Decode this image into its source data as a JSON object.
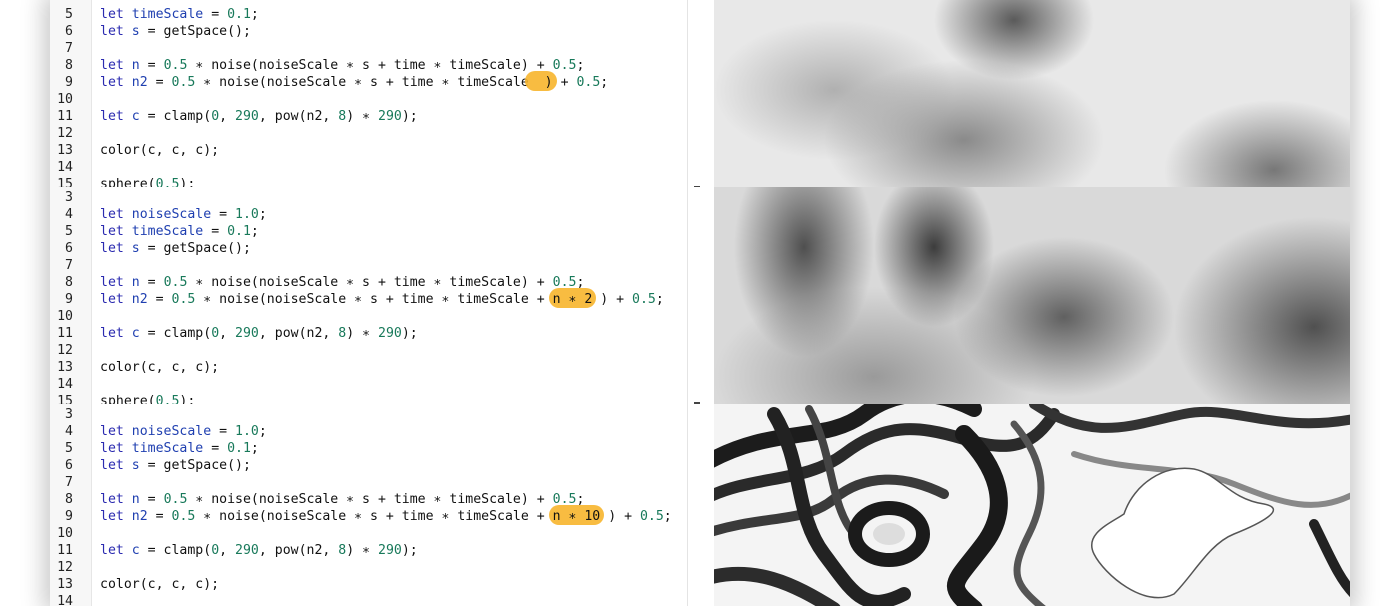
{
  "panels": [
    {
      "lines": [
        {
          "n": "5",
          "tokens": [
            {
              "t": "let",
              "c": "kw"
            },
            {
              "t": " "
            },
            {
              "t": "timeScale",
              "c": "var"
            },
            {
              "t": " = "
            },
            {
              "t": "0.1",
              "c": "num"
            },
            {
              "t": ";"
            }
          ]
        },
        {
          "n": "6",
          "tokens": [
            {
              "t": "let",
              "c": "kw"
            },
            {
              "t": " "
            },
            {
              "t": "s",
              "c": "var"
            },
            {
              "t": " = getSpace();"
            }
          ]
        },
        {
          "n": "7",
          "tokens": []
        },
        {
          "n": "8",
          "tokens": [
            {
              "t": "let",
              "c": "kw"
            },
            {
              "t": " "
            },
            {
              "t": "n",
              "c": "var"
            },
            {
              "t": " = "
            },
            {
              "t": "0.5",
              "c": "num"
            },
            {
              "t": " ∗ noise(noiseScale ∗ s + time ∗ timeScale) + "
            },
            {
              "t": "0.5",
              "c": "num"
            },
            {
              "t": ";"
            }
          ]
        },
        {
          "n": "9",
          "tokens": [
            {
              "t": "let",
              "c": "kw"
            },
            {
              "t": " "
            },
            {
              "t": "n2",
              "c": "var"
            },
            {
              "t": " = "
            },
            {
              "t": "0.5",
              "c": "num"
            },
            {
              "t": " ∗ noise(noiseScale ∗ s + time ∗ timeScale"
            },
            {
              "t": "  )",
              "hl": true
            },
            {
              "t": " + "
            },
            {
              "t": "0.5",
              "c": "num"
            },
            {
              "t": ";"
            }
          ]
        },
        {
          "n": "10",
          "tokens": []
        },
        {
          "n": "11",
          "tokens": [
            {
              "t": "let",
              "c": "kw"
            },
            {
              "t": " "
            },
            {
              "t": "c",
              "c": "var"
            },
            {
              "t": " = clamp("
            },
            {
              "t": "0",
              "c": "num"
            },
            {
              "t": ", "
            },
            {
              "t": "290",
              "c": "num"
            },
            {
              "t": ", pow(n2, "
            },
            {
              "t": "8",
              "c": "num"
            },
            {
              "t": ") ∗ "
            },
            {
              "t": "290",
              "c": "num"
            },
            {
              "t": ");"
            }
          ]
        },
        {
          "n": "12",
          "tokens": []
        },
        {
          "n": "13",
          "tokens": [
            {
              "t": "color(c, c, c);"
            }
          ]
        },
        {
          "n": "14",
          "tokens": []
        },
        {
          "n": "15",
          "tokens": [
            {
              "t": "sphere("
            },
            {
              "t": "0.5",
              "c": "num"
            },
            {
              "t": ");"
            }
          ]
        }
      ]
    },
    {
      "lines": [
        {
          "n": "3",
          "tokens": []
        },
        {
          "n": "4",
          "tokens": [
            {
              "t": "let",
              "c": "kw"
            },
            {
              "t": " "
            },
            {
              "t": "noiseScale",
              "c": "var"
            },
            {
              "t": " = "
            },
            {
              "t": "1.0",
              "c": "num"
            },
            {
              "t": ";"
            }
          ]
        },
        {
          "n": "5",
          "tokens": [
            {
              "t": "let",
              "c": "kw"
            },
            {
              "t": " "
            },
            {
              "t": "timeScale",
              "c": "var"
            },
            {
              "t": " = "
            },
            {
              "t": "0.1",
              "c": "num"
            },
            {
              "t": ";"
            }
          ]
        },
        {
          "n": "6",
          "tokens": [
            {
              "t": "let",
              "c": "kw"
            },
            {
              "t": " "
            },
            {
              "t": "s",
              "c": "var"
            },
            {
              "t": " = getSpace();"
            }
          ]
        },
        {
          "n": "7",
          "tokens": []
        },
        {
          "n": "8",
          "tokens": [
            {
              "t": "let",
              "c": "kw"
            },
            {
              "t": " "
            },
            {
              "t": "n",
              "c": "var"
            },
            {
              "t": " = "
            },
            {
              "t": "0.5",
              "c": "num"
            },
            {
              "t": " ∗ noise(noiseScale ∗ s + time ∗ timeScale) + "
            },
            {
              "t": "0.5",
              "c": "num"
            },
            {
              "t": ";"
            }
          ]
        },
        {
          "n": "9",
          "tokens": [
            {
              "t": "let",
              "c": "kw"
            },
            {
              "t": " "
            },
            {
              "t": "n2",
              "c": "var"
            },
            {
              "t": " = "
            },
            {
              "t": "0.5",
              "c": "num"
            },
            {
              "t": " ∗ noise(noiseScale ∗ s + time ∗ timeScale + "
            },
            {
              "t": "n ∗ 2",
              "hl": true
            },
            {
              "t": " ) + "
            },
            {
              "t": "0.5",
              "c": "num"
            },
            {
              "t": ";"
            }
          ]
        },
        {
          "n": "10",
          "tokens": []
        },
        {
          "n": "11",
          "tokens": [
            {
              "t": "let",
              "c": "kw"
            },
            {
              "t": " "
            },
            {
              "t": "c",
              "c": "var"
            },
            {
              "t": " = clamp("
            },
            {
              "t": "0",
              "c": "num"
            },
            {
              "t": ", "
            },
            {
              "t": "290",
              "c": "num"
            },
            {
              "t": ", pow(n2, "
            },
            {
              "t": "8",
              "c": "num"
            },
            {
              "t": ") ∗ "
            },
            {
              "t": "290",
              "c": "num"
            },
            {
              "t": ");"
            }
          ]
        },
        {
          "n": "12",
          "tokens": []
        },
        {
          "n": "13",
          "tokens": [
            {
              "t": "color(c, c, c);"
            }
          ]
        },
        {
          "n": "14",
          "tokens": []
        },
        {
          "n": "15",
          "tokens": [
            {
              "t": "sphere("
            },
            {
              "t": "0.5",
              "c": "num"
            },
            {
              "t": ");"
            }
          ]
        }
      ]
    },
    {
      "lines": [
        {
          "n": "3",
          "tokens": []
        },
        {
          "n": "4",
          "tokens": [
            {
              "t": "let",
              "c": "kw"
            },
            {
              "t": " "
            },
            {
              "t": "noiseScale",
              "c": "var"
            },
            {
              "t": " = "
            },
            {
              "t": "1.0",
              "c": "num"
            },
            {
              "t": ";"
            }
          ]
        },
        {
          "n": "5",
          "tokens": [
            {
              "t": "let",
              "c": "kw"
            },
            {
              "t": " "
            },
            {
              "t": "timeScale",
              "c": "var"
            },
            {
              "t": " = "
            },
            {
              "t": "0.1",
              "c": "num"
            },
            {
              "t": ";"
            }
          ]
        },
        {
          "n": "6",
          "tokens": [
            {
              "t": "let",
              "c": "kw"
            },
            {
              "t": " "
            },
            {
              "t": "s",
              "c": "var"
            },
            {
              "t": " = getSpace();"
            }
          ]
        },
        {
          "n": "7",
          "tokens": []
        },
        {
          "n": "8",
          "tokens": [
            {
              "t": "let",
              "c": "kw"
            },
            {
              "t": " "
            },
            {
              "t": "n",
              "c": "var"
            },
            {
              "t": " = "
            },
            {
              "t": "0.5",
              "c": "num"
            },
            {
              "t": " ∗ noise(noiseScale ∗ s + time ∗ timeScale) + "
            },
            {
              "t": "0.5",
              "c": "num"
            },
            {
              "t": ";"
            }
          ]
        },
        {
          "n": "9",
          "tokens": [
            {
              "t": "let",
              "c": "kw"
            },
            {
              "t": " "
            },
            {
              "t": "n2",
              "c": "var"
            },
            {
              "t": " = "
            },
            {
              "t": "0.5",
              "c": "num"
            },
            {
              "t": " ∗ noise(noiseScale ∗ s + time ∗ timeScale + "
            },
            {
              "t": "n ∗ 10",
              "hl": true
            },
            {
              "t": " ) + "
            },
            {
              "t": "0.5",
              "c": "num"
            },
            {
              "t": ";"
            }
          ]
        },
        {
          "n": "10",
          "tokens": []
        },
        {
          "n": "11",
          "tokens": [
            {
              "t": "let",
              "c": "kw"
            },
            {
              "t": " "
            },
            {
              "t": "c",
              "c": "var"
            },
            {
              "t": " = clamp("
            },
            {
              "t": "0",
              "c": "num"
            },
            {
              "t": ", "
            },
            {
              "t": "290",
              "c": "num"
            },
            {
              "t": ", pow(n2, "
            },
            {
              "t": "8",
              "c": "num"
            },
            {
              "t": ") ∗ "
            },
            {
              "t": "290",
              "c": "num"
            },
            {
              "t": ");"
            }
          ]
        },
        {
          "n": "12",
          "tokens": []
        },
        {
          "n": "13",
          "tokens": [
            {
              "t": "color(c, c, c);"
            }
          ]
        },
        {
          "n": "14",
          "tokens": []
        }
      ]
    }
  ],
  "colors": {
    "keyword": "#2b2bb0",
    "variable": "#1f3fb0",
    "number": "#18795a",
    "highlight": "#f7b52c"
  }
}
